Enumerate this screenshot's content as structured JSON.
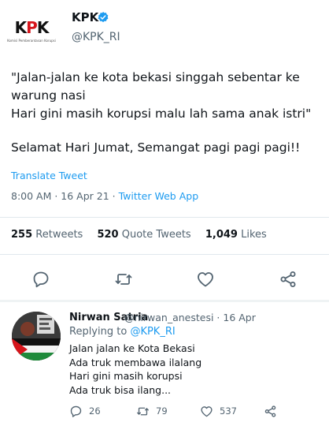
{
  "tweet": {
    "author": {
      "name": "KPK",
      "handle": "@KPK_RI",
      "verified": true,
      "logo_text": "KPK",
      "logo_subtext": "Komisi Pemberantasan Korupsi"
    },
    "text_lines": [
      "\"Jalan-jalan ke kota bekasi singgah sebentar ke warung nasi",
      "Hari gini masih korupsi malu lah sama anak istri\""
    ],
    "closing_line": "Selamat Hari Jumat, Semangat pagi pagi pagi!!",
    "translate_label": "Translate Tweet",
    "timestamp": "8:00 AM · 16 Apr 21 · ",
    "source_app": "Twitter Web App",
    "stats": {
      "retweets_count": "255",
      "retweets_label": "Retweets",
      "quotes_count": "520",
      "quotes_label": "Quote Tweets",
      "likes_count": "1,049",
      "likes_label": "Likes"
    },
    "actions": [
      "reply-icon",
      "retweet-icon",
      "like-icon",
      "share-icon"
    ]
  },
  "reply": {
    "author_name": "Nirwan Satria",
    "meta": "@nirwan_anestesi · 16 Apr",
    "replying_prefix": "Replying to ",
    "replying_to": "@KPK_RI",
    "lines": [
      "Jalan jalan ke Kota Bekasi",
      "Ada truk membawa ilalang",
      "Hari gini masih korupsi",
      "Ada truk bisa ilang..."
    ],
    "reply_count": "26",
    "retweet_count": "79",
    "like_count": "537"
  },
  "colors": {
    "link": "#1d9bf0",
    "muted": "#536471",
    "text": "#0f1419",
    "kpk_red": "#d6151c"
  }
}
